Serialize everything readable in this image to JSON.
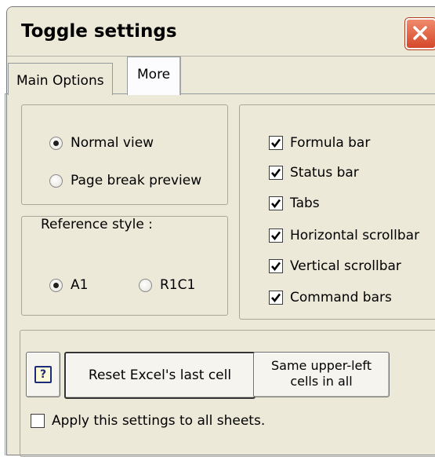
{
  "window": {
    "title": "Toggle settings"
  },
  "tabs": [
    {
      "label": "Main Options",
      "selected": false
    },
    {
      "label": "More",
      "selected": true
    }
  ],
  "view_group": {
    "options": [
      {
        "label": "Normal view",
        "selected": true
      },
      {
        "label": "Page break preview",
        "selected": false
      }
    ]
  },
  "reference_style": {
    "legend": "Reference style :",
    "options": [
      {
        "label": "A1",
        "selected": true
      },
      {
        "label": "R1C1",
        "selected": false
      }
    ]
  },
  "toggles": [
    {
      "label": "Formula bar",
      "checked": true
    },
    {
      "label": "Status bar",
      "checked": true
    },
    {
      "label": "Tabs",
      "checked": true
    },
    {
      "label": "Horizontal scrollbar",
      "checked": true
    },
    {
      "label": "Vertical scrollbar",
      "checked": true
    },
    {
      "label": "Command bars",
      "checked": true
    }
  ],
  "buttons": {
    "help_icon": "question-icon",
    "help_glyph": "?",
    "reset_label": "Reset Excel's last cell",
    "same_line1": "Same upper-left",
    "same_line2": "cells in all"
  },
  "apply_all": {
    "label": "Apply this settings to all sheets.",
    "checked": false
  },
  "colors": {
    "dialog_bg": "#ece9d8",
    "close_button": "#d5482a"
  }
}
